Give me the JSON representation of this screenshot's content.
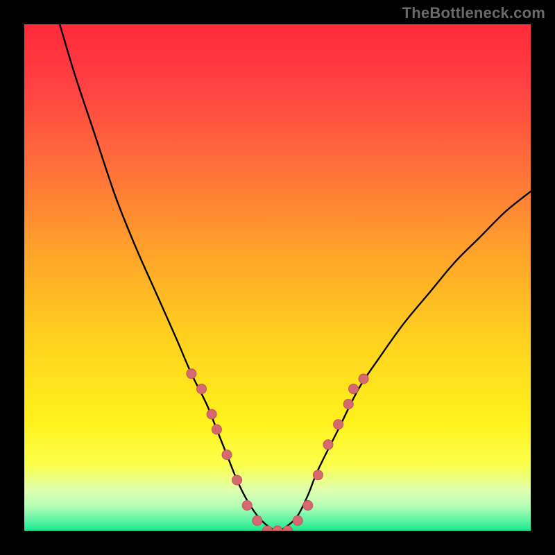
{
  "watermark": "TheBottleneck.com",
  "colors": {
    "frame": "#000000",
    "curve_stroke": "#000000",
    "marker_fill": "#d46a6f",
    "marker_stroke": "#c45058",
    "gradient_stops": [
      {
        "offset": 0.0,
        "color": "#ff2a3a"
      },
      {
        "offset": 0.12,
        "color": "#ff4142"
      },
      {
        "offset": 0.28,
        "color": "#ff6f3a"
      },
      {
        "offset": 0.46,
        "color": "#ffa62a"
      },
      {
        "offset": 0.62,
        "color": "#ffd11f"
      },
      {
        "offset": 0.78,
        "color": "#fff11b"
      },
      {
        "offset": 0.87,
        "color": "#fbff4a"
      },
      {
        "offset": 0.92,
        "color": "#dfffb0"
      },
      {
        "offset": 0.95,
        "color": "#b8ffb6"
      },
      {
        "offset": 0.975,
        "color": "#6cf6a9"
      },
      {
        "offset": 1.0,
        "color": "#19e88f"
      }
    ]
  },
  "chart_data": {
    "type": "line",
    "title": "",
    "xlabel": "",
    "ylabel": "",
    "xlim": [
      0,
      100
    ],
    "ylim": [
      0,
      100
    ],
    "grid": false,
    "legend": false,
    "series": [
      {
        "name": "bottleneck-curve",
        "x": [
          7,
          10,
          14,
          18,
          22,
          26,
          30,
          33,
          36,
          38,
          40,
          42,
          44,
          46,
          48,
          50,
          52,
          54,
          56,
          58,
          62,
          66,
          70,
          75,
          80,
          85,
          90,
          95,
          100
        ],
        "y": [
          100,
          90,
          78,
          66,
          56,
          47,
          38,
          31,
          25,
          20,
          15,
          10,
          6,
          3,
          1,
          0,
          1,
          3,
          7,
          12,
          20,
          28,
          34,
          41,
          47,
          53,
          58,
          63,
          67
        ]
      }
    ],
    "markers": {
      "name": "curve-data-points",
      "x": [
        33,
        35,
        37,
        38,
        40,
        42,
        44,
        46,
        48,
        50,
        52,
        54,
        56,
        58,
        60,
        62,
        64,
        65,
        67
      ],
      "y": [
        31,
        28,
        23,
        20,
        15,
        10,
        5,
        2,
        0,
        0,
        0,
        2,
        5,
        11,
        17,
        21,
        25,
        28,
        30
      ]
    }
  }
}
